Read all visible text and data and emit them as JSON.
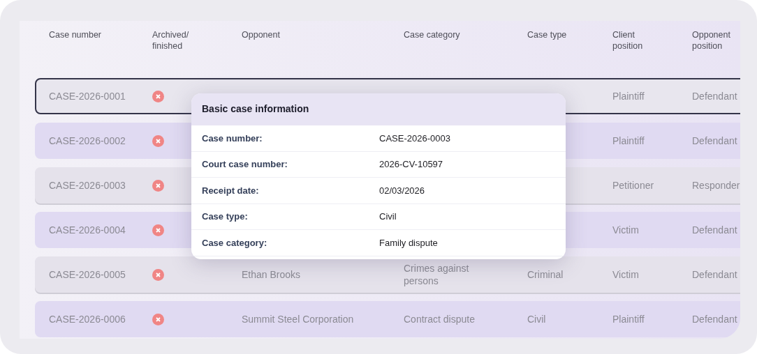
{
  "table": {
    "columns": [
      "Case number",
      "Archived/ finished",
      "Opponent",
      "Case category",
      "Case type",
      "Client position",
      "Opponent position"
    ],
    "rows": [
      {
        "case_number": "CASE-2026-0001",
        "archived": false,
        "selected": true,
        "client_position": "Plaintiff",
        "opponent_position": "Defendant"
      },
      {
        "case_number": "CASE-2026-0002",
        "archived": false,
        "selected": false,
        "client_position": "Plaintiff",
        "opponent_position": "Defendant"
      },
      {
        "case_number": "CASE-2026-0003",
        "archived": false,
        "selected": false,
        "client_position": "Petitioner",
        "opponent_position": "Responder"
      },
      {
        "case_number": "CASE-2026-0004",
        "archived": false,
        "selected": false,
        "client_position": "Victim",
        "opponent_position": "Defendant"
      },
      {
        "case_number": "CASE-2026-0005",
        "archived": false,
        "selected": false,
        "opponent": "Ethan Brooks",
        "case_category": "Crimes against persons",
        "case_type": "Criminal",
        "client_position": "Victim",
        "opponent_position": "Defendant"
      },
      {
        "case_number": "CASE-2026-0006",
        "archived": false,
        "selected": false,
        "opponent": "Summit Steel Corporation",
        "case_category": "Contract dispute",
        "case_type": "Civil",
        "client_position": "Plaintiff",
        "opponent_position": "Defendant"
      }
    ]
  },
  "popup": {
    "title": "Basic case information",
    "fields": [
      {
        "label": "Case number:",
        "value": "CASE-2026-0003"
      },
      {
        "label": "Court case number:",
        "value": "2026-CV-10597"
      },
      {
        "label": "Receipt date:",
        "value": "02/03/2026"
      },
      {
        "label": "Case type:",
        "value": "Civil"
      },
      {
        "label": "Case category:",
        "value": "Family dispute"
      }
    ]
  }
}
